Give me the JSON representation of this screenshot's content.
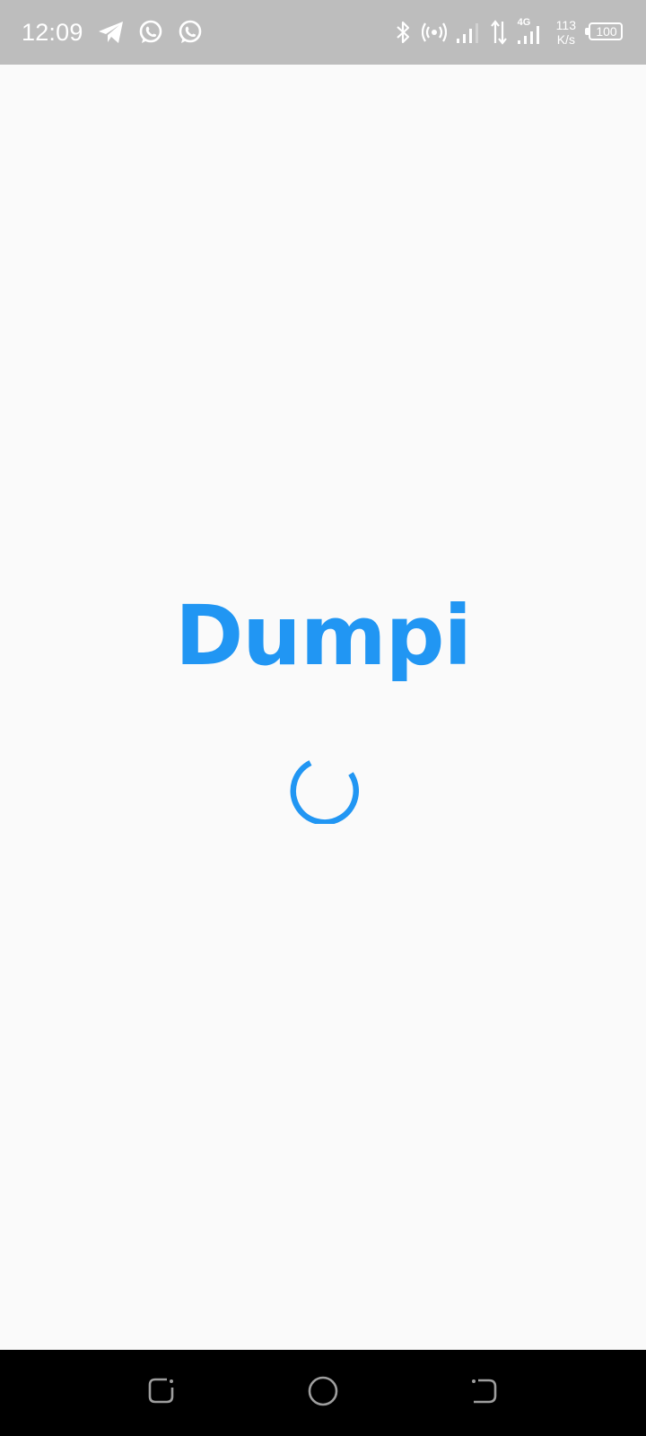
{
  "status_bar": {
    "time": "12:09",
    "notification_icons": [
      "telegram-icon",
      "whatsapp-icon",
      "whatsapp-icon"
    ],
    "system_icons": [
      "bluetooth-icon",
      "hotspot-icon",
      "signal-icon",
      "data-transfer-icon",
      "signal-4g-icon"
    ],
    "network_type": "4G",
    "speed_value": "113",
    "speed_unit": "K/s",
    "battery_level": "100"
  },
  "splash": {
    "app_name": "Dumpi",
    "loading": true
  },
  "colors": {
    "brand": "#2196f3",
    "background": "#fafafa",
    "status_bar": "#bdbdbd",
    "nav_bar": "#000000",
    "nav_icon": "#9e9e9e"
  },
  "nav_bar": {
    "buttons": [
      "recents-icon",
      "home-icon",
      "back-icon"
    ]
  }
}
